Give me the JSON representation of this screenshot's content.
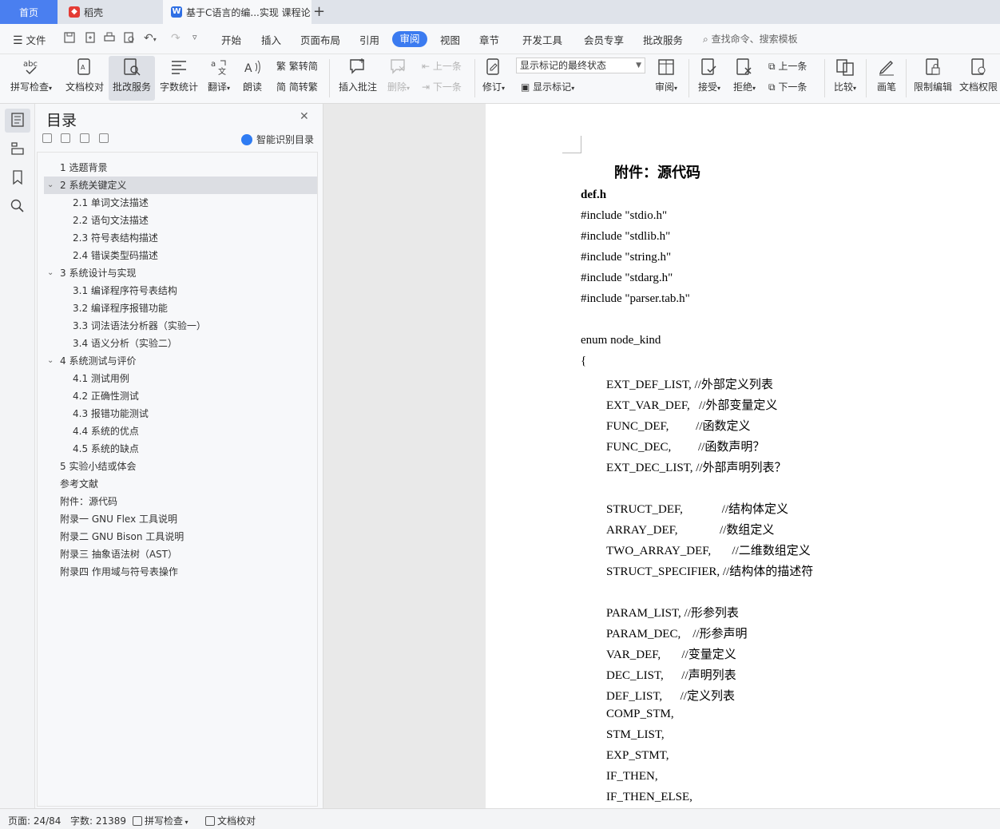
{
  "tabs": {
    "home": "首页",
    "doc1": "稻壳",
    "doc2": "基于C语言的编...实现 课程论"
  },
  "menu": {
    "file": "文件",
    "items": [
      "开始",
      "插入",
      "页面布局",
      "引用",
      "审阅",
      "视图",
      "章节",
      "开发工具",
      "会员专享",
      "批改服务"
    ],
    "active": "审阅",
    "search_placeholder": "查找命令、搜索模板"
  },
  "ribbon": {
    "spellcheck": "拼写检查",
    "doc_proof": "文档校对",
    "correction_service": "批改服务",
    "word_count": "字数统计",
    "translate": "翻译",
    "read_aloud": "朗读",
    "trad_to_simp": "繁转简",
    "simp_to_trad": "简转繁",
    "insert_comment": "插入批注",
    "delete": "删除",
    "prev_comment": "上一条",
    "next_comment": "下一条",
    "revise": "修订",
    "markup_state": "显示标记的最终状态",
    "show_markup": "显示标记",
    "review": "审阅",
    "accept": "接受",
    "reject": "拒绝",
    "prev_change": "上一条",
    "next_change": "下一条",
    "compare": "比较",
    "pen": "画笔",
    "restrict_edit": "限制编辑",
    "doc_permission": "文档权限"
  },
  "toc": {
    "title": "目录",
    "ai_toc": "智能识别目录",
    "items": [
      {
        "label": "1 选题背景",
        "level": 1,
        "caret": ""
      },
      {
        "label": "2 系统关键定义",
        "level": 1,
        "caret": "v"
      },
      {
        "label": "2.1 单词文法描述",
        "level": 2,
        "caret": ""
      },
      {
        "label": "2.2 语句文法描述",
        "level": 2,
        "caret": ""
      },
      {
        "label": "2.3  符号表结构描述",
        "level": 2,
        "caret": ""
      },
      {
        "label": "2.4  错误类型码描述",
        "level": 2,
        "caret": ""
      },
      {
        "label": "3 系统设计与实现",
        "level": 1,
        "caret": "v"
      },
      {
        "label": "3.1 编译程序符号表结构",
        "level": 2,
        "caret": ""
      },
      {
        "label": "3.2 编译程序报错功能",
        "level": 2,
        "caret": ""
      },
      {
        "label": "3.3 词法语法分析器（实验一）",
        "level": 2,
        "caret": ""
      },
      {
        "label": "3.4 语义分析（实验二）",
        "level": 2,
        "caret": ""
      },
      {
        "label": "4 系统测试与评价",
        "level": 1,
        "caret": "v"
      },
      {
        "label": "4.1  测试用例",
        "level": 2,
        "caret": ""
      },
      {
        "label": "4.2  正确性测试",
        "level": 2,
        "caret": ""
      },
      {
        "label": "4.3  报错功能测试",
        "level": 2,
        "caret": ""
      },
      {
        "label": "4.4  系统的优点",
        "level": 2,
        "caret": ""
      },
      {
        "label": "4.5  系统的缺点",
        "level": 2,
        "caret": ""
      },
      {
        "label": "5 实验小结或体会",
        "level": 1,
        "caret": ""
      },
      {
        "label": "参考文献",
        "level": 1,
        "caret": ""
      },
      {
        "label": "附件：源代码",
        "level": 1,
        "caret": ""
      },
      {
        "label": "附录一  GNU Flex  工具说明",
        "level": 1,
        "caret": ""
      },
      {
        "label": "附录二  GNU Bison  工具说明",
        "level": 1,
        "caret": ""
      },
      {
        "label": "附录三  抽象语法树（AST）",
        "level": 1,
        "caret": ""
      },
      {
        "label": "附录四  作用域与符号表操作",
        "level": 1,
        "caret": ""
      }
    ],
    "highlighted_index": 1
  },
  "document": {
    "heading": "附件：源代码",
    "filename": "def.h",
    "lines": [
      "#include \"stdio.h\"",
      "#include \"stdlib.h\"",
      "#include \"string.h\"",
      "#include \"stdarg.h\"",
      "#include \"parser.tab.h\"",
      "",
      "enum node_kind",
      "{",
      "EXT_DEF_LIST, //外部定义列表",
      "EXT_VAR_DEF,   //外部变量定义",
      "FUNC_DEF,         //函数定义",
      "FUNC_DEC,         //函数声明？",
      "EXT_DEC_LIST, //外部声明列表？",
      "",
      "STRUCT_DEF,             //结构体定义",
      "ARRAY_DEF,              //数组定义",
      "TWO_ARRAY_DEF,       //二维数组定义",
      "STRUCT_SPECIFIER, //结构体的描述符",
      "",
      "PARAM_LIST, //形参列表",
      "PARAM_DEC,    //形参声明",
      "VAR_DEF,       //变量定义",
      "DEC_LIST,      //声明列表",
      "DEF_LIST,      //定义列表",
      "COMP_STM,",
      "STM_LIST,",
      "EXP_STMT,",
      "IF_THEN,",
      "IF_THEN_ELSE,"
    ]
  },
  "status": {
    "page": "页面: 24/84",
    "words": "字数: 21389",
    "spell": "拼写检查",
    "proof": "文档校对"
  }
}
